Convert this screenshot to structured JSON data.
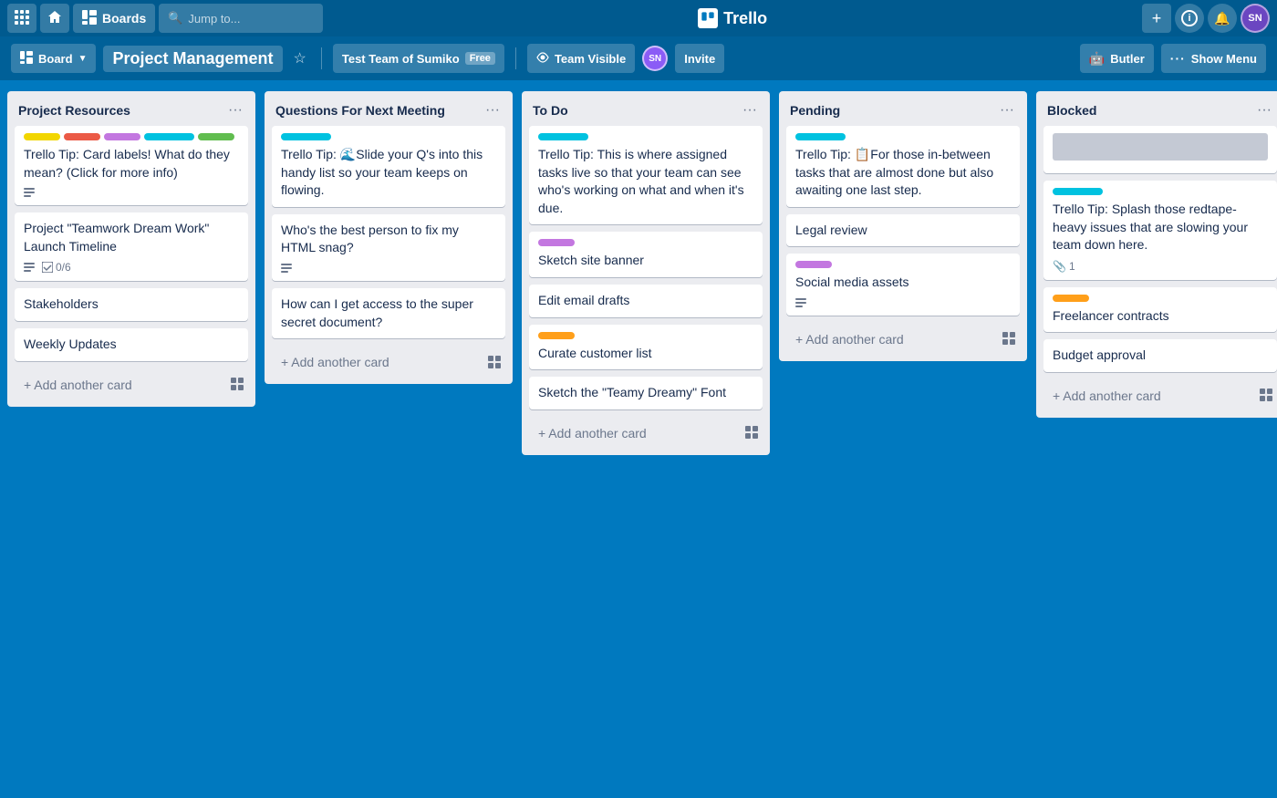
{
  "topNav": {
    "appsIcon": "⊞",
    "homeIcon": "⌂",
    "boardsLabel": "Boards",
    "searchPlaceholder": "Jump to...",
    "searchIcon": "🔍",
    "logoText": "Trello",
    "addIcon": "+",
    "infoIcon": "ℹ",
    "bellIcon": "🔔",
    "userInitials": "SN"
  },
  "boardBar": {
    "boardIcon": "□",
    "boardLabel": "Board",
    "boardDropdownIcon": "▼",
    "title": "Project Management",
    "starIcon": "☆",
    "teamLabel": "Test Team of Sumiko",
    "freeBadge": "Free",
    "visibilityIcon": "👁",
    "visibilityLabel": "Team Visible",
    "userInitials": "SN",
    "inviteLabel": "Invite",
    "butlerIcon": "🤖",
    "butlerLabel": "Butler",
    "showMenuIcon": "···",
    "showMenuLabel": "Show Menu"
  },
  "lists": [
    {
      "id": "project-resources",
      "title": "Project Resources",
      "cards": [
        {
          "id": "pr-1",
          "labels": [
            "yellow",
            "red",
            "purple",
            "teal",
            "green"
          ],
          "text": "Trello Tip: Card labels! What do they mean? (Click for more info)",
          "hasDescription": true
        },
        {
          "id": "pr-2",
          "labels": [],
          "text": "Project \"Teamwork Dream Work\" Launch Timeline",
          "hasDescription": true,
          "hasChecklist": true,
          "checklistProgress": "0/6"
        },
        {
          "id": "pr-3",
          "labels": [],
          "text": "Stakeholders",
          "hasDescription": false
        },
        {
          "id": "pr-4",
          "labels": [],
          "text": "Weekly Updates",
          "hasDescription": false
        }
      ],
      "addCardLabel": "+ Add another card"
    },
    {
      "id": "questions-next-meeting",
      "title": "Questions For Next Meeting",
      "cards": [
        {
          "id": "qm-1",
          "labels": [
            "cyan"
          ],
          "text": "Trello Tip: 🌊Slide your Q's into this handy list so your team keeps on flowing.",
          "hasDescription": false
        },
        {
          "id": "qm-2",
          "labels": [],
          "text": "Who's the best person to fix my HTML snag?",
          "hasDescription": true
        },
        {
          "id": "qm-3",
          "labels": [],
          "text": "How can I get access to the super secret document?",
          "hasDescription": false
        }
      ],
      "addCardLabel": "+ Add another card"
    },
    {
      "id": "to-do",
      "title": "To Do",
      "cards": [
        {
          "id": "td-1",
          "labels": [
            "cyan"
          ],
          "text": "Trello Tip: This is where assigned tasks live so that your team can see who's working on what and when it's due.",
          "hasDescription": false
        },
        {
          "id": "td-2",
          "labels": [
            "purple2"
          ],
          "text": "Sketch site banner",
          "hasDescription": false
        },
        {
          "id": "td-3",
          "labels": [],
          "text": "Edit email drafts",
          "hasDescription": false
        },
        {
          "id": "td-4",
          "labels": [
            "orange"
          ],
          "text": "Curate customer list",
          "hasDescription": false
        },
        {
          "id": "td-5",
          "labels": [],
          "text": "Sketch the \"Teamy Dreamy\" Font",
          "hasDescription": false
        }
      ],
      "addCardLabel": "+ Add another card"
    },
    {
      "id": "pending",
      "title": "Pending",
      "cards": [
        {
          "id": "pe-1",
          "labels": [
            "cyan"
          ],
          "text": "Trello Tip: 📋For those in-between tasks that are almost done but also awaiting one last step.",
          "hasDescription": false
        },
        {
          "id": "pe-2",
          "labels": [],
          "text": "Legal review",
          "hasDescription": false
        },
        {
          "id": "pe-3",
          "labels": [
            "purple2"
          ],
          "text": "Social media assets",
          "hasDescription": true
        }
      ],
      "addCardLabel": "+ Add another card"
    },
    {
      "id": "blocked",
      "title": "Blocked",
      "cards": [
        {
          "id": "bl-1",
          "labels": [
            "gray"
          ],
          "text": "",
          "isGrayBlock": true
        },
        {
          "id": "bl-2",
          "labels": [
            "cyan"
          ],
          "text": "Trello Tip: Splash those redtape-heavy issues that are slowing your team down here.",
          "hasAttachment": true,
          "attachmentCount": "1"
        },
        {
          "id": "bl-3",
          "labels": [
            "orange"
          ],
          "text": "Freelancer contracts",
          "hasDescription": false
        },
        {
          "id": "bl-4",
          "labels": [],
          "text": "Budget approval",
          "hasDescription": false
        }
      ],
      "addCardLabel": "+ Add another card"
    }
  ]
}
